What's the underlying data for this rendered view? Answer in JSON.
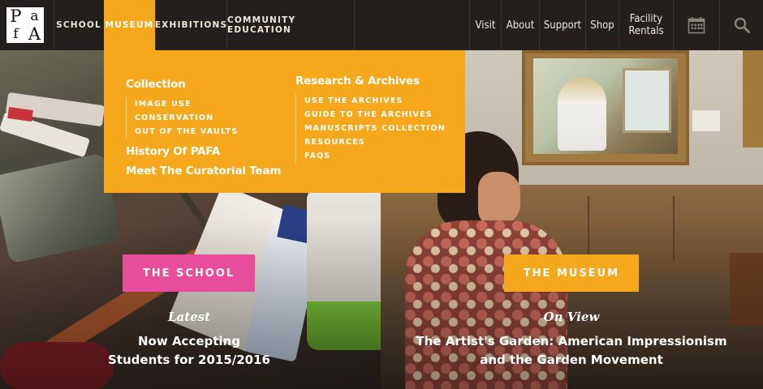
{
  "logo": {
    "letters": [
      "P",
      "a",
      "f",
      "A"
    ]
  },
  "nav": {
    "left": [
      {
        "label": "SCHOOL",
        "active": false
      },
      {
        "label": "MUSEUM",
        "active": true
      },
      {
        "label": "EXHIBITIONS",
        "active": false
      },
      {
        "label": "COMMUNITY EDUCATION",
        "active": false
      }
    ],
    "right": [
      {
        "label": "Visit"
      },
      {
        "label": "About"
      },
      {
        "label": "Support"
      },
      {
        "label": "Shop"
      },
      {
        "label_line1": "Facility",
        "label_line2": "Rentals"
      }
    ],
    "icons": [
      "calendar-icon",
      "search-icon"
    ]
  },
  "mega_menu": {
    "col1": {
      "heading": "Collection",
      "links": [
        "IMAGE USE",
        "CONSERVATION",
        "OUT OF THE VAULTS"
      ],
      "extra_headings": [
        "History Of PAFA",
        "Meet The Curatorial Team"
      ]
    },
    "col2": {
      "heading": "Research & Archives",
      "links": [
        "USE THE ARCHIVES",
        "GUIDE TO THE ARCHIVES",
        "MANUSCRIPTS COLLECTION",
        "RESOURCES",
        "FAQS"
      ]
    }
  },
  "panels": {
    "school": {
      "cta": "THE SCHOOL",
      "kicker": "Latest",
      "title_line1": "Now Accepting",
      "title_line2": "Students for 2015/2016"
    },
    "museum": {
      "cta": "THE MUSEUM",
      "kicker": "On View",
      "title_line1": "The Artist's Garden: American Impressionism",
      "title_line2": "and the Garden Movement"
    }
  },
  "colors": {
    "nav_bg": "#231f1c",
    "accent_orange": "#f5a81b",
    "accent_pink": "#e84d9c",
    "text_light": "#ede7df"
  }
}
